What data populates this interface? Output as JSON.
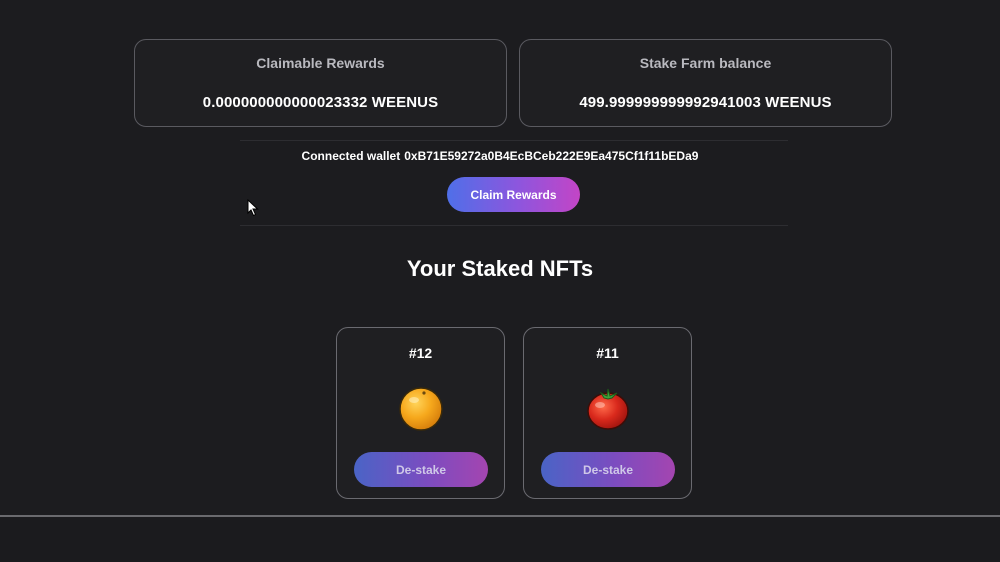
{
  "rewards": {
    "claimable_label": "Claimable Rewards",
    "claimable_value": "0.000000000000023332 WEENUS",
    "balance_label": "Stake Farm balance",
    "balance_value": "499.999999999992941003 WEENUS"
  },
  "wallet": {
    "label": "Connected wallet",
    "address": "0xB71E59272a0B4EcBCeb222E9Ea475Cf1f11bEDa9"
  },
  "claim_button_label": "Claim Rewards",
  "staked_section": {
    "title": "Your Staked NFTs",
    "nfts": [
      {
        "id": "#12",
        "image_icon": "orange-icon",
        "button_label": "De-stake"
      },
      {
        "id": "#11",
        "image_icon": "tomato-icon",
        "button_label": "De-stake"
      }
    ]
  },
  "colors": {
    "background": "#1c1c1f",
    "gradient_start": "#4f6fe8",
    "gradient_end": "#c345c6"
  }
}
